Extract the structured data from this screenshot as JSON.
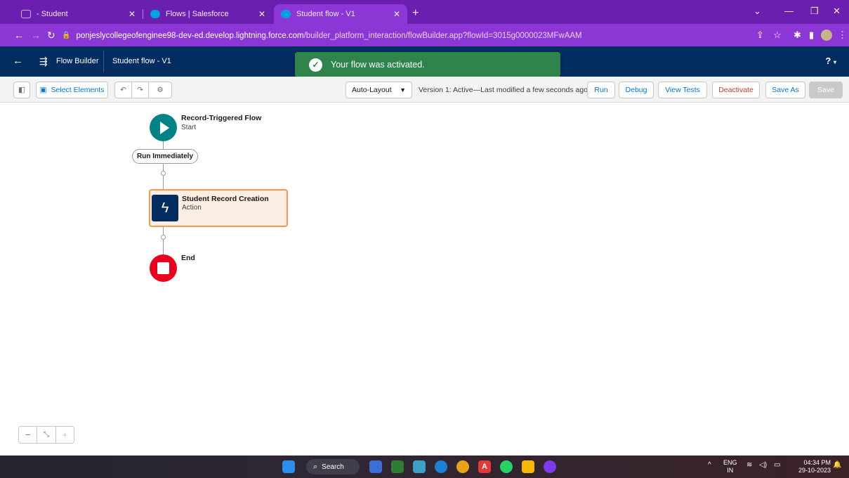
{
  "browser": {
    "tabs": [
      {
        "label": "- Student",
        "color": "#5b6cd6"
      },
      {
        "label": "Flows | Salesforce",
        "color": "#00a1e0"
      },
      {
        "label": "Student flow - V1",
        "color": "#00a1e0"
      }
    ],
    "address": {
      "host": "ponjeslycollegeofenginee98-dev-ed.develop.lightning.force.com",
      "path": "/builder_platform_interaction/flowBuilder.app?flowId=3015g0000023MFwAAM"
    }
  },
  "header": {
    "app_name": "Flow Builder",
    "flow_name": "Student flow - V1",
    "help": "?"
  },
  "toast": {
    "message": "Your flow was activated.",
    "color": "#2e844a"
  },
  "toolbar": {
    "select_elements": "Select Elements",
    "layout": "Auto-Layout",
    "version_text": "Version 1: Active—Last modified a few seconds ago",
    "run": "Run",
    "debug": "Debug",
    "view_tests": "View Tests",
    "deactivate": "Deactivate",
    "save_as": "Save As",
    "save": "Save"
  },
  "canvas": {
    "start": {
      "title": "Record-Triggered Flow",
      "subtitle": "Start"
    },
    "path_label": "Run Immediately",
    "action": {
      "title": "Student Record Creation",
      "subtitle": "Action"
    },
    "end": {
      "title": "End"
    }
  },
  "taskbar": {
    "search": "Search",
    "lang_top": "ENG",
    "lang_bottom": "IN",
    "time": "04:34 PM",
    "date": "29-10-2023"
  }
}
